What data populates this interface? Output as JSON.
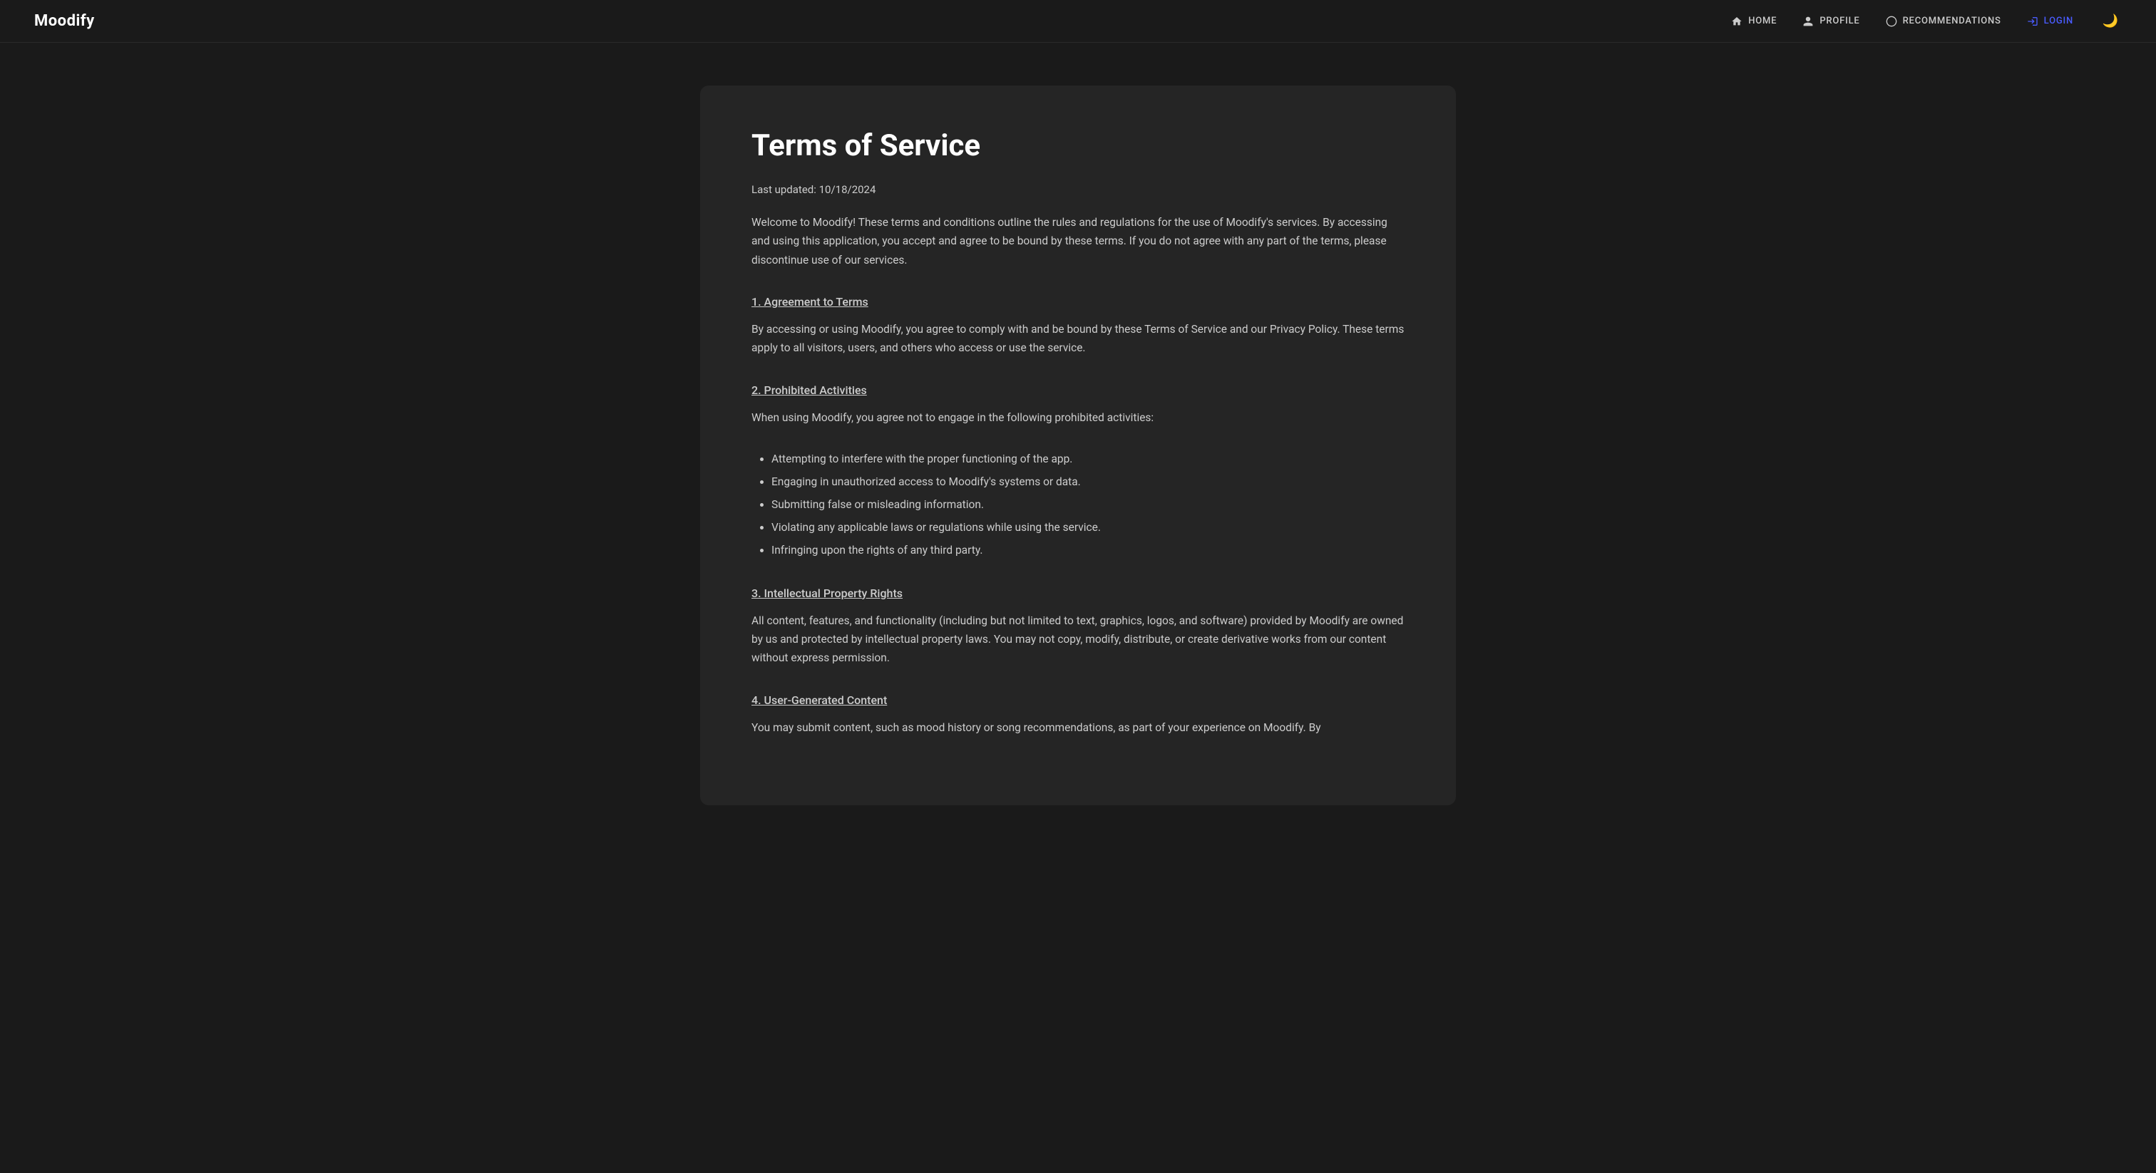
{
  "app": {
    "logo": "Moodify"
  },
  "nav": {
    "links": [
      {
        "id": "home",
        "label": "HOME",
        "icon": "home"
      },
      {
        "id": "profile",
        "label": "PROFILE",
        "icon": "person"
      },
      {
        "id": "recommendations",
        "label": "RECOMMENDATIONS",
        "icon": "circle"
      },
      {
        "id": "login",
        "label": "LOGIN",
        "icon": "login",
        "highlight": true
      }
    ],
    "theme_toggle_icon": "🌙"
  },
  "page": {
    "title": "Terms of Service",
    "last_updated_label": "Last updated: 10/18/2024",
    "intro": "Welcome to Moodify! These terms and conditions outline the rules and regulations for the use of Moodify's services. By accessing and using this application, you accept and agree to be bound by these terms. If you do not agree with any part of the terms, please discontinue use of our services.",
    "sections": [
      {
        "id": "agreement",
        "heading": "1. Agreement to Terms",
        "body": "By accessing or using Moodify, you agree to comply with and be bound by these Terms of Service and our Privacy Policy. These terms apply to all visitors, users, and others who access or use the service.",
        "list": []
      },
      {
        "id": "prohibited",
        "heading": "2. Prohibited Activities",
        "body": "When using Moodify, you agree not to engage in the following prohibited activities:",
        "list": [
          "Attempting to interfere with the proper functioning of the app.",
          "Engaging in unauthorized access to Moodify's systems or data.",
          "Submitting false or misleading information.",
          "Violating any applicable laws or regulations while using the service.",
          "Infringing upon the rights of any third party."
        ]
      },
      {
        "id": "intellectual",
        "heading": "3. Intellectual Property Rights",
        "body": "All content, features, and functionality (including but not limited to text, graphics, logos, and software) provided by Moodify are owned by us and protected by intellectual property laws. You may not copy, modify, distribute, or create derivative works from our content without express permission.",
        "list": []
      },
      {
        "id": "ugc",
        "heading": "4. User-Generated Content",
        "body": "You may submit content, such as mood history or song recommendations, as part of your experience on Moodify. By",
        "list": []
      }
    ]
  }
}
